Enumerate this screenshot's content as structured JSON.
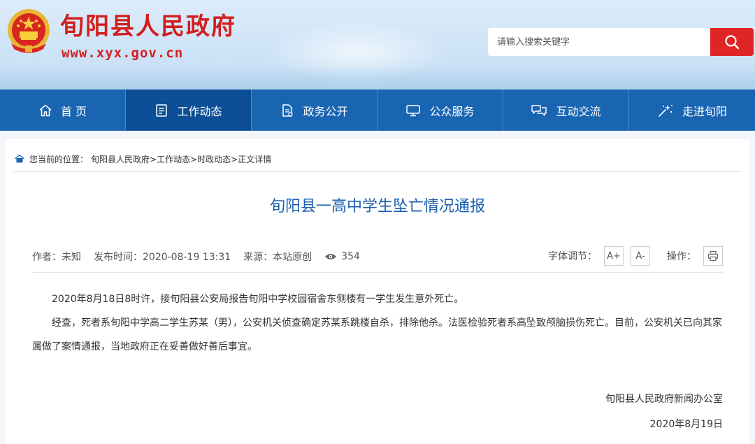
{
  "header": {
    "site_title": "旬阳县人民政府",
    "site_url": "www.xyx.gov.cn",
    "emblem_icon": "national-emblem-icon",
    "brand_red": "#d41e1e"
  },
  "search": {
    "placeholder": "请输入搜索关键字",
    "button_icon": "search-icon",
    "button_color": "#e02525"
  },
  "nav": {
    "items": [
      {
        "label": "首 页",
        "icon": "home-icon"
      },
      {
        "label": "工作动态",
        "icon": "document-icon",
        "active": true
      },
      {
        "label": "政务公开",
        "icon": "file-icon"
      },
      {
        "label": "公众服务",
        "icon": "monitor-icon"
      },
      {
        "label": "互动交流",
        "icon": "chat-icon"
      },
      {
        "label": "走进旬阳",
        "icon": "sparkle-icon"
      }
    ],
    "color": "#1a65b2",
    "active_color": "#0d4f96"
  },
  "breadcrumb": {
    "icon": "location-icon",
    "prefix": "您当前的位置：",
    "items": [
      "旬阳县人民政府>",
      "工作动态>",
      "时政动态>",
      "正文详情"
    ]
  },
  "article": {
    "title": "旬阳县一高中学生坠亡情况通报",
    "meta": {
      "author": "作者：未知",
      "publish_time": "发布时间：2020-08-19 13:31",
      "source": "来源：本站原创",
      "views": "354"
    },
    "tools": {
      "font_size_label": "字体调节：",
      "increase": "A+",
      "decrease": "A-",
      "action_label": "操作：",
      "print_icon": "print-icon"
    },
    "paragraphs": [
      "2020年8月18日8时许，接旬阳县公安局报告旬阳中学校园宿舍东侧楼有一学生发生意外死亡。",
      "经查，死者系旬阳中学高二学生苏某（男），公安机关侦查确定苏某系跳楼自杀，排除他杀。法医检验死者系高坠致颅脑损伤死亡。目前，公安机关已向其家属做了案情通报，当地政府正在妥善做好善后事宜。"
    ],
    "signature": "旬阳县人民政府新闻办公室",
    "date": "2020年8月19日",
    "title_color": "#1b5fae"
  }
}
